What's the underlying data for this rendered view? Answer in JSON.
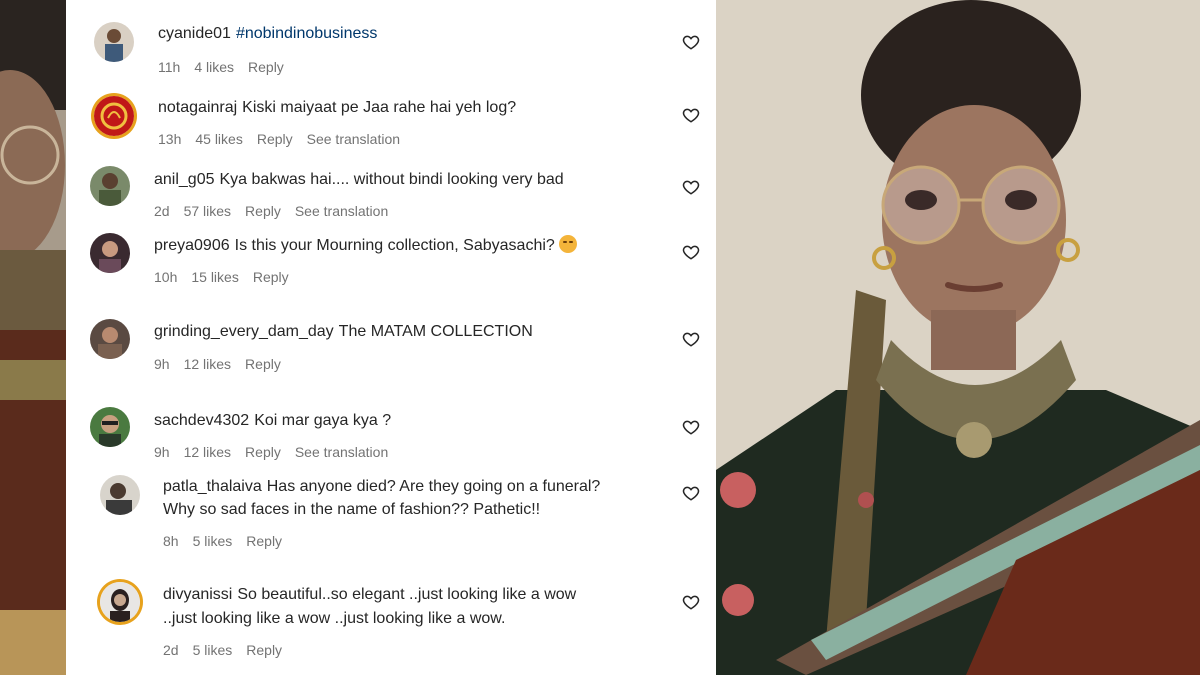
{
  "comments": [
    {
      "username": "cyanide01",
      "text": "",
      "hashtag": "#nobindinobusiness",
      "time": "11h",
      "likes": "4 likes",
      "reply": "Reply",
      "translation": ""
    },
    {
      "username": "notagainraj",
      "text": "Kiski maiyaat pe Jaa rahe hai yeh log?",
      "time": "13h",
      "likes": "45 likes",
      "reply": "Reply",
      "translation": "See translation"
    },
    {
      "username": "anil_g05",
      "text": "Kya bakwas hai.... without bindi looking very bad",
      "time": "2d",
      "likes": "57 likes",
      "reply": "Reply",
      "translation": "See translation"
    },
    {
      "username": "preya0906",
      "text": "Is this your Mourning collection, Sabyasachi?",
      "emoji": "worried-face-emoji",
      "time": "10h",
      "likes": "15 likes",
      "reply": "Reply",
      "translation": ""
    },
    {
      "username": "grinding_every_dam_day",
      "text": "The MATAM COLLECTION",
      "time": "9h",
      "likes": "12 likes",
      "reply": "Reply",
      "translation": ""
    },
    {
      "username": "sachdev4302",
      "text": "Koi mar gaya kya ?",
      "time": "9h",
      "likes": "12 likes",
      "reply": "Reply",
      "translation": "See translation"
    },
    {
      "username": "patla_thalaiva",
      "text": "Has anyone died? Are they going on a funeral?",
      "text2": "Why so sad faces in the name of fashion?? Pathetic!!",
      "time": "8h",
      "likes": "5 likes",
      "reply": "Reply",
      "translation": ""
    },
    {
      "username": "divyanissi",
      "text": "So beautiful..so elegant ..just looking like a wow",
      "text2": "..just looking like a wow ..just looking like a wow.",
      "time": "2d",
      "likes": "5 likes",
      "reply": "Reply",
      "translation": ""
    }
  ],
  "icons": {
    "like": "heart-outline-icon"
  },
  "colors": {
    "text": "#262626",
    "meta": "#737373",
    "hashtag": "#00376b",
    "story_ring": "#e7a21d"
  }
}
